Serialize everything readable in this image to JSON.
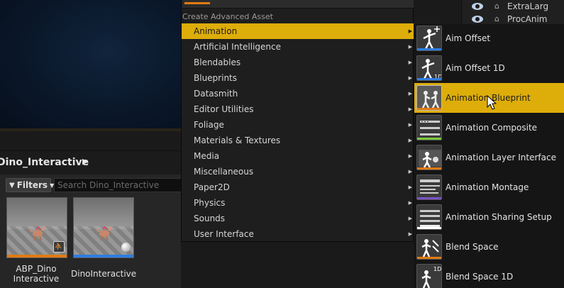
{
  "outliner": {
    "rows": [
      {
        "label": "ExtraLarg"
      },
      {
        "label": "ProcAnim"
      }
    ]
  },
  "content_browser": {
    "path": "Dino_Interactive",
    "filters_label": "Filters",
    "search_placeholder": "Search Dino_Interactive",
    "assets": [
      {
        "name": "ABP_Dino Interactive",
        "line1": "ABP_Dino",
        "line2": "Interactive",
        "color": "#e07b12"
      },
      {
        "name": "DinoInteractive",
        "line1": "DinoInteractive",
        "line2": "",
        "color": "#2f7de1"
      }
    ]
  },
  "menu": {
    "section_title": "Create Advanced Asset",
    "items": [
      {
        "label": "Animation",
        "active": true
      },
      {
        "label": "Artificial Intelligence"
      },
      {
        "label": "Blendables"
      },
      {
        "label": "Blueprints"
      },
      {
        "label": "Datasmith"
      },
      {
        "label": "Editor Utilities"
      },
      {
        "label": "Foliage"
      },
      {
        "label": "Materials & Textures"
      },
      {
        "label": "Media"
      },
      {
        "label": "Miscellaneous"
      },
      {
        "label": "Paper2D"
      },
      {
        "label": "Physics"
      },
      {
        "label": "Sounds"
      },
      {
        "label": "User Interface"
      }
    ]
  },
  "submenu": {
    "items": [
      {
        "label": "Aim Offset",
        "icon": "aim-offset-icon"
      },
      {
        "label": "Aim Offset 1D",
        "icon": "aim-offset-1d-icon"
      },
      {
        "label": "Animation Blueprint",
        "icon": "animation-blueprint-icon",
        "active": true
      },
      {
        "label": "Animation Composite",
        "icon": "animation-composite-icon"
      },
      {
        "label": "Animation Layer Interface",
        "icon": "animation-layer-interface-icon"
      },
      {
        "label": "Animation Montage",
        "icon": "animation-montage-icon"
      },
      {
        "label": "Animation Sharing Setup",
        "icon": "animation-sharing-setup-icon"
      },
      {
        "label": "Blend Space",
        "icon": "blend-space-icon"
      },
      {
        "label": "Blend Space 1D",
        "icon": "blend-space-1d-icon"
      }
    ]
  },
  "colors": {
    "highlight": "#ddad0a",
    "accent_orange": "#e07b12",
    "accent_blue": "#2f7de1",
    "accent_green": "#79c93a"
  }
}
